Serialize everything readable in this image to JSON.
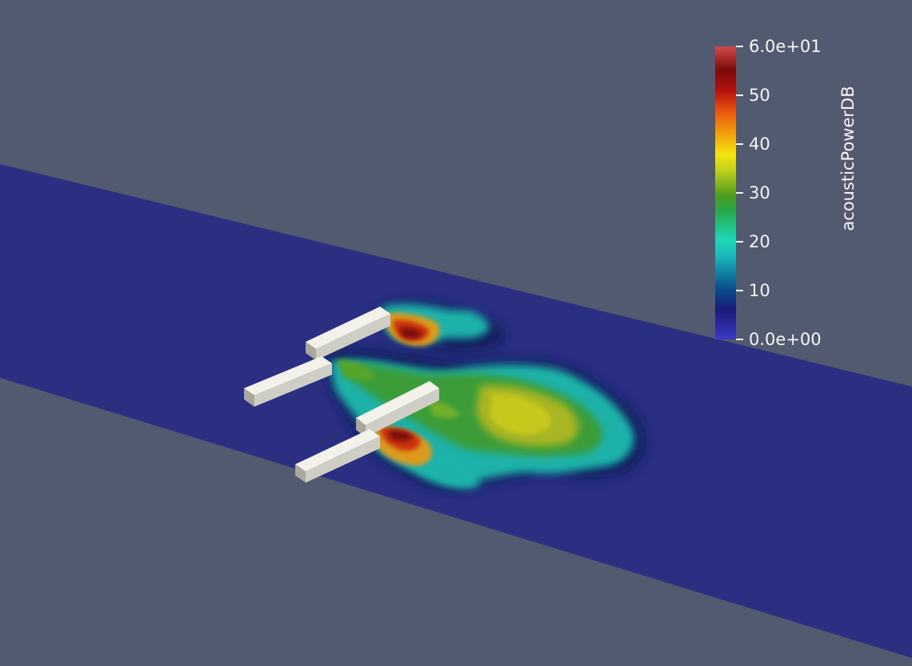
{
  "legend": {
    "title": "acousticPowerDB",
    "ticks": [
      {
        "label": "6.0e+01",
        "value": 60
      },
      {
        "label": "50",
        "value": 50
      },
      {
        "label": "40",
        "value": 40
      },
      {
        "label": "30",
        "value": 30
      },
      {
        "label": "20",
        "value": 20
      },
      {
        "label": "10",
        "value": 10
      },
      {
        "label": "0.0e+00",
        "value": 0
      }
    ],
    "range": [
      0,
      60
    ]
  },
  "colors": {
    "background": "#525a6f",
    "domain": "#2b2f82",
    "blade": "#deddd4"
  }
}
